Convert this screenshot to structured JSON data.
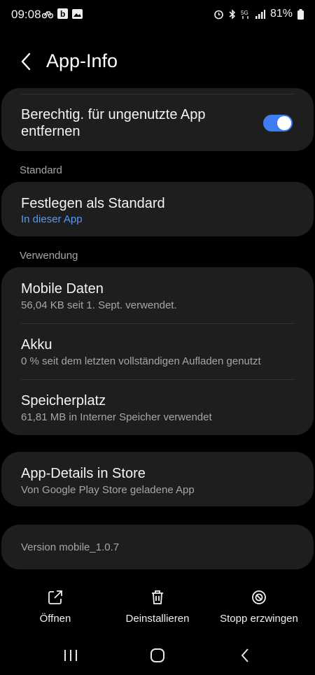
{
  "status_bar": {
    "time": "09:08",
    "battery": "81%",
    "left_icons": [
      "bike-icon",
      "b-app-icon",
      "image-icon"
    ],
    "right_icons": [
      "alarm-icon",
      "bluetooth-icon",
      "5g-icon",
      "signal-icon",
      "battery-icon"
    ]
  },
  "header": {
    "title": "App-Info"
  },
  "permissions_card": {
    "label": "Berechtig. für ungenutzte App entfernen",
    "toggle_on": true
  },
  "standard_section": {
    "heading": "Standard",
    "item": {
      "title": "Festlegen als Standard",
      "subtitle": "In dieser App"
    }
  },
  "usage_section": {
    "heading": "Verwendung",
    "items": [
      {
        "title": "Mobile Daten",
        "subtitle": "56,04 KB seit 1. Sept. verwendet."
      },
      {
        "title": "Akku",
        "subtitle": "0 % seit dem letzten vollständigen Aufladen genutzt"
      },
      {
        "title": "Speicherplatz",
        "subtitle": "61,81 MB in Interner Speicher verwendet"
      }
    ]
  },
  "store_card": {
    "title": "App-Details in Store",
    "subtitle": "Von Google Play Store geladene App"
  },
  "version_card": {
    "text": "Version mobile_1.0.7"
  },
  "bottom_actions": [
    {
      "label": "Öffnen",
      "icon": "open-external-icon"
    },
    {
      "label": "Deinstallieren",
      "icon": "trash-icon"
    },
    {
      "label": "Stopp erzwingen",
      "icon": "block-icon"
    }
  ],
  "colors": {
    "accent": "#3f7df1",
    "link": "#5a9af0",
    "card": "#1e1e1e",
    "background": "#000000"
  }
}
